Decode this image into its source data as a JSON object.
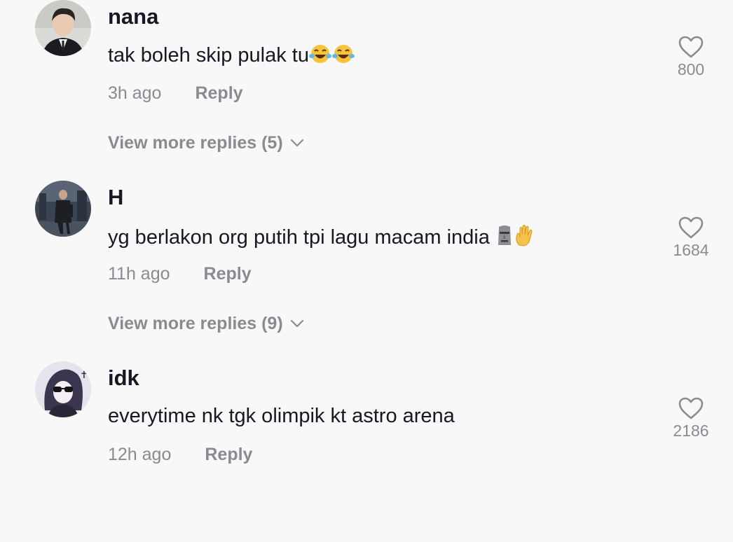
{
  "comments": [
    {
      "username": "nana",
      "text": "tak boleh skip pulak tu",
      "emoji": [
        "face-with-tears-of-joy",
        "face-with-tears-of-joy"
      ],
      "time": "3h ago",
      "reply_label": "Reply",
      "like_count": "800",
      "view_more": "View more replies (5)"
    },
    {
      "username": "H",
      "text": "yg berlakon org putih tpi lagu macam india ",
      "emoji": [
        "moai",
        "raised-hand"
      ],
      "time": "11h ago",
      "reply_label": "Reply",
      "like_count": "1684",
      "view_more": "View more replies (9)"
    },
    {
      "username": "idk",
      "text": "everytime nk tgk olimpik kt astro arena",
      "emoji": [],
      "time": "12h ago",
      "reply_label": "Reply",
      "like_count": "2186"
    }
  ],
  "colors": {
    "background": "#f8f8f8",
    "primary_text": "#161823",
    "secondary_text": "#8a8b91"
  }
}
